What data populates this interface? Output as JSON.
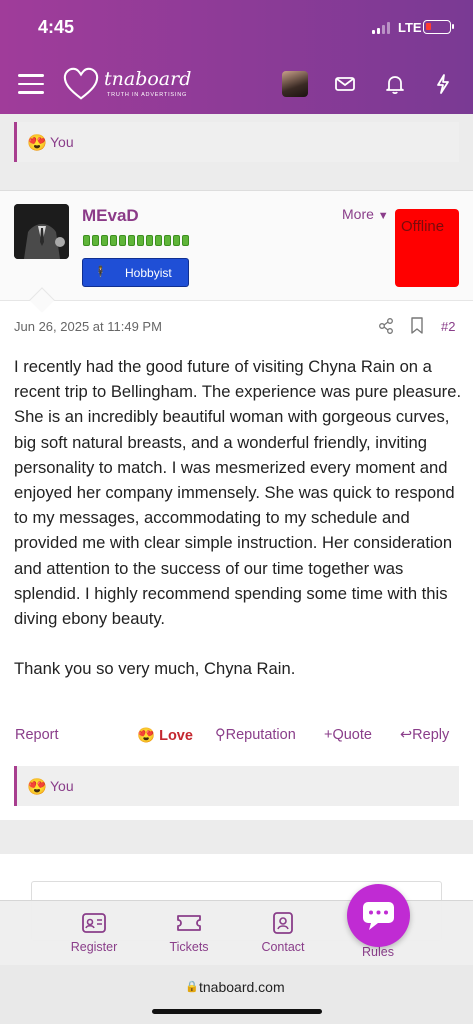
{
  "status": {
    "time": "4:45",
    "network": "LTE"
  },
  "header": {
    "logo_text": "tnaboard",
    "logo_tagline": "TRUTH IN ADVERTISING",
    "icons": [
      "menu-icon",
      "avatar",
      "mail-icon",
      "bell-icon",
      "bolt-icon"
    ]
  },
  "prev_reaction": {
    "label": "You",
    "emoji": "😍"
  },
  "post": {
    "username": "MEvaD",
    "rank_badge": "Hobbyist",
    "rank_icon": "🕴",
    "more_label": "More",
    "status_label": "Offline",
    "reputation_bars": 12,
    "date": "Jun 26, 2025 at 11:49 PM",
    "post_number": "#2",
    "paragraphs": [
      "I recently had the good future of visiting Chyna Rain on a recent trip to Bellingham. The experience was pure pleasure. She is an incredibly beautiful woman with gorgeous curves, big soft natural breasts, and a wonderful friendly, inviting personality to match. I was mesmerized every moment and enjoyed her company immensely. She was quick to respond to my messages, accommodating to my schedule and provided me with clear simple instruction. Her consideration and attention to the success of our time together was splendid. I highly recommend spending some time with this diving ebony beauty.",
      "Thank you so very much, Chyna Rain."
    ],
    "actions": {
      "report": "Report",
      "love": "Love",
      "love_emoji": "😍",
      "reputation": "Reputation",
      "quote": "Quote",
      "reply": "Reply"
    },
    "reaction": {
      "label": "You",
      "emoji": "😍"
    }
  },
  "bottom_nav": {
    "items": [
      {
        "label": "Register",
        "icon": "id-card-icon"
      },
      {
        "label": "Tickets",
        "icon": "ticket-icon"
      },
      {
        "label": "Contact",
        "icon": "contact-icon"
      },
      {
        "label": "Rules",
        "icon": "chat-icon"
      }
    ]
  },
  "browser": {
    "url": "tnaboard.com"
  },
  "colors": {
    "brand_purple": "#8a3e8a",
    "offline_red": "#ff0000",
    "badge_blue": "#1f4fd6",
    "fab_magenta": "#c02bd3"
  }
}
